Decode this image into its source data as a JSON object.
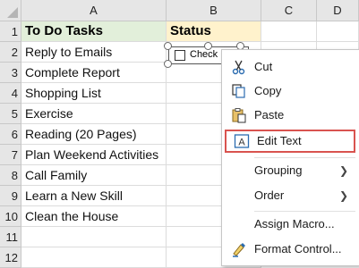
{
  "columns": [
    "A",
    "B",
    "C",
    "D"
  ],
  "rows": [
    "1",
    "2",
    "3",
    "4",
    "5",
    "6",
    "7",
    "8",
    "9",
    "10",
    "11",
    "12"
  ],
  "table": {
    "header_a": "To Do Tasks",
    "header_b": "Status",
    "tasks": [
      "Reply to Emails",
      "Complete Report",
      "Shopping List",
      "Exercise",
      "Reading (20 Pages)",
      "Plan Weekend Activities",
      "Call Family",
      "Learn a New Skill",
      "Clean the House"
    ]
  },
  "checkbox": {
    "label": "Check Box"
  },
  "context_menu": {
    "items": [
      {
        "label": "Cut",
        "icon": "scissors-icon"
      },
      {
        "label": "Copy",
        "icon": "copy-icon"
      },
      {
        "label": "Paste",
        "icon": "paste-icon"
      },
      {
        "label": "Edit Text",
        "icon": "edit-text-icon",
        "highlighted": true
      },
      {
        "label": "Grouping",
        "submenu": true
      },
      {
        "label": "Order",
        "submenu": true
      },
      {
        "label": "Assign Macro..."
      },
      {
        "label": "Format Control...",
        "icon": "format-control-icon"
      }
    ]
  },
  "colors": {
    "header_a_fill": "#e2efda",
    "header_b_fill": "#fff2cc",
    "highlight_border": "#d9534f",
    "icon_blue": "#2b6cb0"
  }
}
